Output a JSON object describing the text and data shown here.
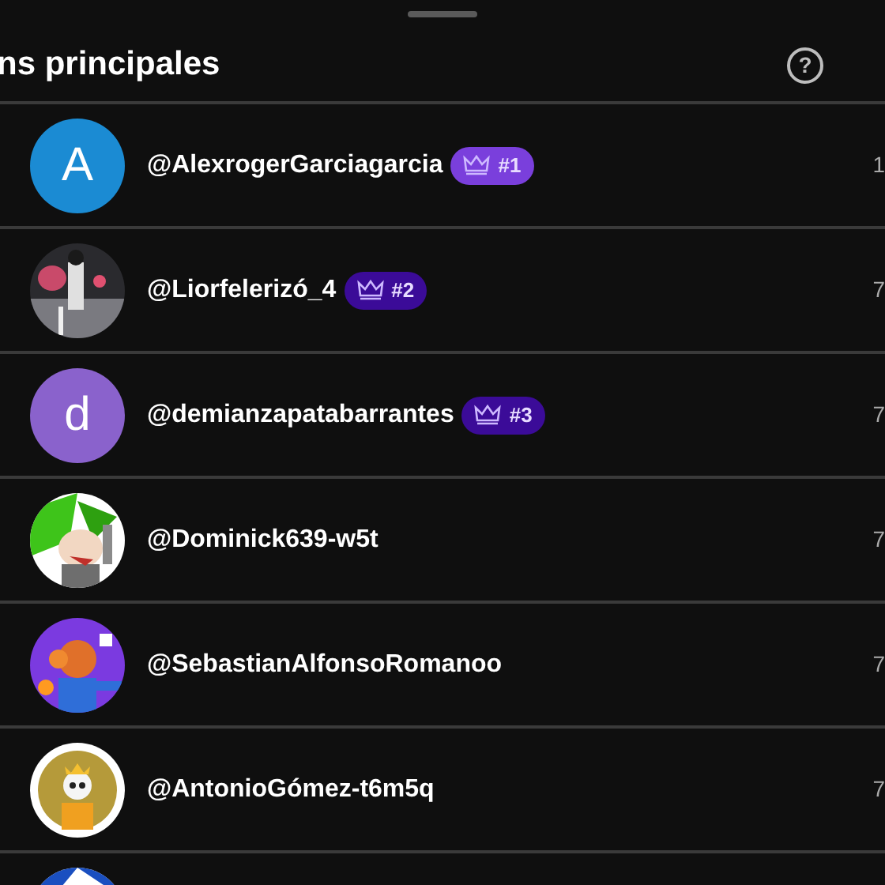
{
  "header": {
    "title": "ns principales",
    "help": "?"
  },
  "fans": [
    {
      "avatar": {
        "kind": "letter",
        "letter": "A",
        "color": "#1b8bd3"
      },
      "handle": "@AlexrogerGarciagarcia",
      "badge": {
        "rank": "#1",
        "color": "#7a3fdc"
      },
      "value": "1"
    },
    {
      "avatar": {
        "kind": "picture"
      },
      "handle": "@Liorfelerizó_4",
      "badge": {
        "rank": "#2",
        "color": "#3b0b98"
      },
      "value": "7"
    },
    {
      "avatar": {
        "kind": "letter",
        "letter": "d",
        "color": "#8a62cc"
      },
      "handle": "@demianzapatabarrantes",
      "badge": {
        "rank": "#3",
        "color": "#3b0b98"
      },
      "value": "7"
    },
    {
      "avatar": {
        "kind": "picture"
      },
      "handle": "@Dominick639-w5t",
      "value": "7"
    },
    {
      "avatar": {
        "kind": "picture"
      },
      "handle": "@SebastianAlfonsoRomanoo",
      "value": "7"
    },
    {
      "avatar": {
        "kind": "picture"
      },
      "handle": "@AntonioGómez-t6m5q",
      "value": "7"
    },
    {
      "avatar": {
        "kind": "picture"
      }
    }
  ]
}
